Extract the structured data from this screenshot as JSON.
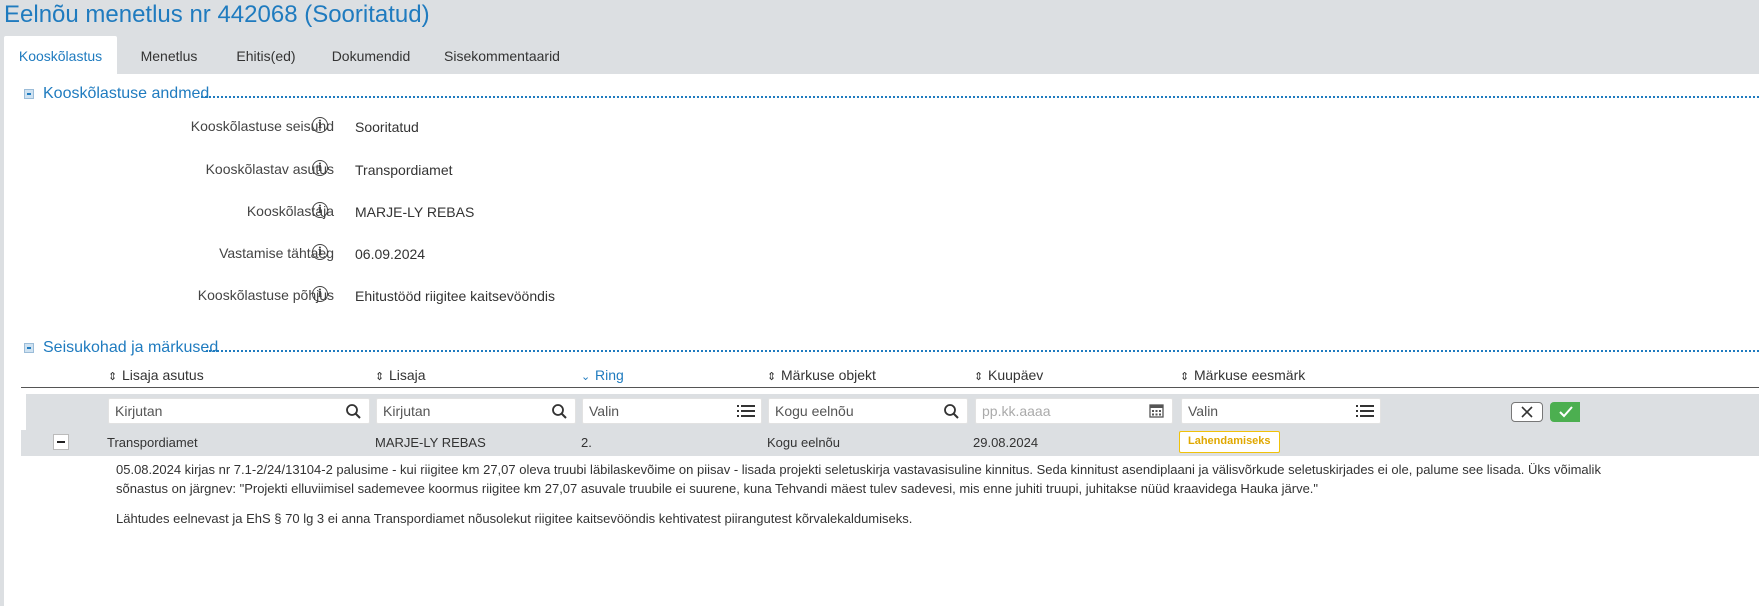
{
  "page": {
    "title": "Eelnõu menetlus nr 442068 (Sooritatud)"
  },
  "tabs": [
    {
      "label": "Kooskõlastus",
      "active": true
    },
    {
      "label": "Menetlus"
    },
    {
      "label": "Ehitis(ed)"
    },
    {
      "label": "Dokumendid"
    },
    {
      "label": "Sisekommentaarid"
    }
  ],
  "section1": {
    "title": "Kooskõlastuse andmed",
    "fields": [
      {
        "label": "Kooskõlastuse seisund",
        "value": "Sooritatud"
      },
      {
        "label": "Kooskõlastav asutus",
        "value": "Transpordiamet"
      },
      {
        "label": "Kooskõlastaja",
        "value": "MARJE-LY REBAS"
      },
      {
        "label": "Vastamise tähtaeg",
        "value": "06.09.2024"
      },
      {
        "label": "Kooskõlastuse põhjus",
        "value": "Ehitustööd riigitee kaitsevööndis"
      }
    ]
  },
  "section2": {
    "title": "Seisukohad ja märkused",
    "columns": [
      {
        "label": "Lisaja asutus",
        "sort": "both"
      },
      {
        "label": "Lisaja",
        "sort": "both"
      },
      {
        "label": "Ring",
        "sort": "desc"
      },
      {
        "label": "Märkuse objekt",
        "sort": "both"
      },
      {
        "label": "Kuupäev",
        "sort": "both"
      },
      {
        "label": "Märkuse eesmärk",
        "sort": "both"
      }
    ],
    "filters": {
      "lisaja_asutus": {
        "placeholder": "Kirjutan",
        "icon": "search-icon"
      },
      "lisaja": {
        "placeholder": "Kirjutan",
        "icon": "search-icon"
      },
      "ring": {
        "placeholder": "Valin",
        "icon": "list-icon"
      },
      "markuse_objekt": {
        "value": "Kogu eelnõu",
        "icon": "search-icon"
      },
      "kuupaev": {
        "placeholder": "pp.kk.aaaa",
        "icon": "calendar-icon"
      },
      "markuse_eesmark": {
        "placeholder": "Valin",
        "icon": "list-icon"
      }
    },
    "rows": [
      {
        "asutus": "Transpordiamet",
        "lisaja": "MARJE-LY REBAS",
        "ring": "2.",
        "objekt": "Kogu eelnõu",
        "kuupaev": "29.08.2024",
        "eesmark": "Lahendamiseks",
        "text_lines": [
          "05.08.2024 kirjas nr 7.1-2/24/13104-2 palusime - kui riigitee km 27,07 oleva truubi läbilaskevõime on piisav - lisada projekti seletuskirja vastavasisuline kinnitus. Seda kinnitust asendiplaani ja välisvõrkude seletuskirjades ei ole, palume see lisada. Üks võimalik",
          "sõnastus on järgnev: \"Projekti elluviimisel sademevee koormus riigitee km 27,07 asuvale truubile ei suurene, kuna Tehvandi mäest tulev sadevesi, mis enne juhiti truupi,  juhitakse nüüd kraavidega Hauka järve.\"",
          "Lähtudes eelnevast ja EhS § 70 lg 3 ei anna Transpordiamet nõusolekut riigitee kaitsevööndis kehtivatest piirangutest kõrvalekaldumiseks."
        ]
      }
    ]
  },
  "colors": {
    "accent": "#1f7bbf",
    "badge": "#f0c20a",
    "ok": "#4caf50"
  }
}
